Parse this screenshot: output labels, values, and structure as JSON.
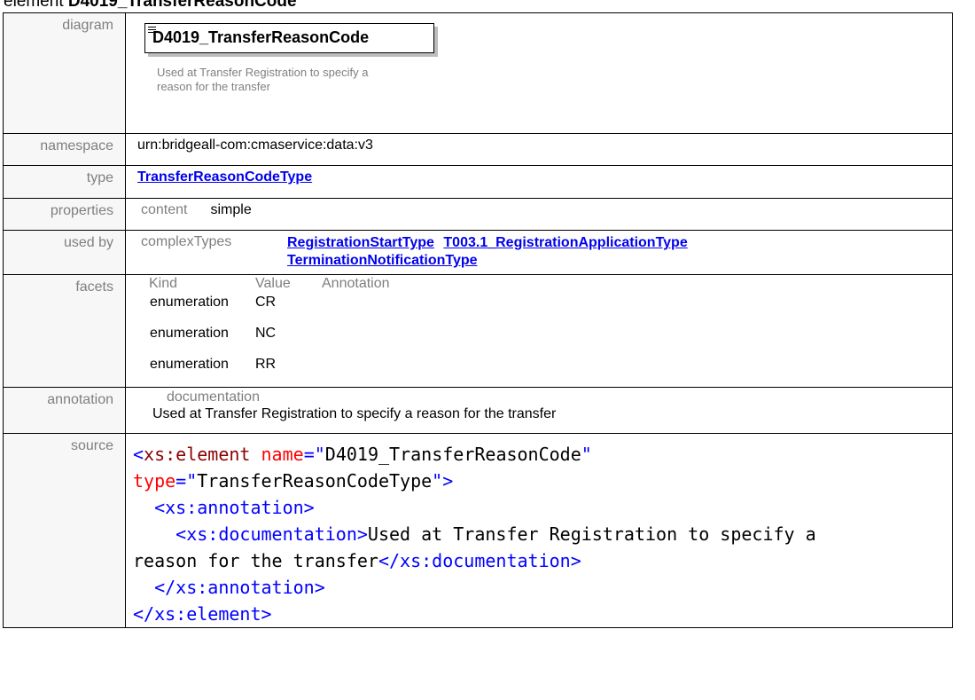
{
  "heading": {
    "prefix": "element ",
    "name": "D4019_TransferReasonCode"
  },
  "labels": {
    "diagram": "diagram",
    "namespace": "namespace",
    "type": "type",
    "properties": "properties",
    "used_by": "used by",
    "facets": "facets",
    "annotation": "annotation",
    "source": "source"
  },
  "diagram": {
    "element_name": "D4019_TransferReasonCode",
    "documentation": "Used at Transfer Registration to specify a reason for the transfer"
  },
  "namespace": "urn:bridgeall-com:cmaservice:data:v3",
  "type_link": "TransferReasonCodeType",
  "properties": {
    "key": "content",
    "value": "simple"
  },
  "used_by": {
    "kind": "complexTypes",
    "links": [
      "RegistrationStartType",
      "T003.1_RegistrationApplicationType",
      "TerminationNotificationType"
    ]
  },
  "facets": {
    "headers": [
      "Kind",
      "Value",
      "Annotation"
    ],
    "rows": [
      {
        "kind": "enumeration",
        "value": "CR"
      },
      {
        "kind": "enumeration",
        "value": "NC"
      },
      {
        "kind": "enumeration",
        "value": "RR"
      }
    ]
  },
  "annotation": {
    "label": "documentation",
    "text": "Used at Transfer Registration to specify a reason for the transfer"
  },
  "source": {
    "l1_open": "<",
    "l1_tag": "xs:element",
    "l1_attr1": "name",
    "l1_eq1": "=\"",
    "l1_val1": "D4019_TransferReasonCode",
    "l1_q1": "\"",
    "l2_attr2": "type",
    "l2_eq2": "=\"",
    "l2_val2": "TransferReasonCodeType",
    "l2_close": "\">",
    "l3_tag": "<xs:annotation>",
    "l4_open": "<xs:documentation>",
    "l4_text": "Used at Transfer Registration to specify a",
    "l5_text": "reason for the transfer",
    "l5_close": "</xs:documentation>",
    "l6_tag": "</xs:annotation>",
    "l7_tag": "</xs:element>"
  },
  "colors": {
    "link": "#0000ee",
    "tag": "#8b0000",
    "bracket": "#0000ff",
    "attribute": "#ff0000",
    "label": "#7f7f7f"
  }
}
